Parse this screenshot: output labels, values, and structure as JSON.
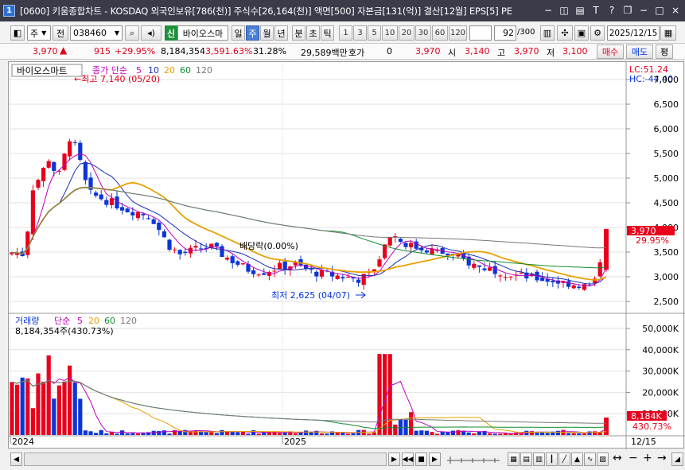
{
  "titlebar": {
    "num": "1",
    "title": "[0600] 키움종합차트 - KOSDAQ 외국인보유[786(천)] 주식수[26,164(천)] 액면[500] 자본금[131(억)] 결산[12월] EPS[5] PE",
    "buttons": [
      "−",
      "◫",
      "▤",
      "T",
      "?",
      "❐",
      "−",
      "□",
      "×"
    ]
  },
  "toolbar": {
    "period_select": "주",
    "prev_label": "전",
    "code": "038460",
    "new_badge": "신",
    "stock_name": "바이오스마",
    "periods": [
      "일",
      "주",
      "월",
      "년",
      "분",
      "초",
      "틱"
    ],
    "selected_period": "주",
    "intervals": [
      "1",
      "3",
      "5",
      "10",
      "20",
      "30",
      "60",
      "120"
    ],
    "count_value": "92",
    "count_total": "/300",
    "date": "2025/12/15"
  },
  "pricebar": {
    "price": "3,970",
    "change": "915",
    "change_pct": "+29.95%",
    "volume": "8,184,354",
    "volume_pct": "3,591.63%",
    "turnover": "31.28%",
    "amount": "29,589백만",
    "hoga_label": "호가",
    "hoga_value": "0",
    "price2": "3,970",
    "low_mark": "시",
    "open": "3,140",
    "high_label": "고",
    "high": "3,970",
    "low_label": "저",
    "low": "3,100",
    "buy_btn": "매수",
    "sell_btn": "매도",
    "eval_btn": "평"
  },
  "chart": {
    "stock_label": "바이오스마트",
    "ma_title": "종가 단순",
    "ma_periods": [
      "5",
      "10",
      "20",
      "60",
      "120"
    ],
    "high_annotation": "←최고 7,140 (05/20)",
    "low_annotation": "최저 2,625 (04/07)",
    "dividend_annotation": "배당락(0.00%)",
    "lc": "LC:51.24",
    "hc": "HC:-44.40",
    "y_ticks": [
      "7,000",
      "6,500",
      "6,000",
      "5,500",
      "5,000",
      "4,500",
      "4,000",
      "3,500",
      "3,000",
      "2,500"
    ],
    "last_price_tag": "3,970",
    "last_pct_tag": "29.95%",
    "vol_title": "거래량",
    "vol_ma_title": "단순",
    "vol_ma_periods": [
      "5",
      "20",
      "60",
      "120"
    ],
    "vol_value": "8,184,354주(430.73%)",
    "vol_ticks": [
      "50,000K",
      "40,000K",
      "30,000K",
      "20,000K",
      "10,000K"
    ],
    "vol_tag": "8,184K",
    "vol_pct_tag": "430.73%",
    "x_labels": [
      "2024",
      "2025",
      "12/15"
    ],
    "colors": {
      "up": "#e8001c",
      "down": "#0a35d8",
      "ma5": "#c000c0",
      "ma10": "#1a2fb8",
      "ma20": "#e8a000",
      "ma60": "#108a30",
      "ma120": "#777777"
    }
  }
}
